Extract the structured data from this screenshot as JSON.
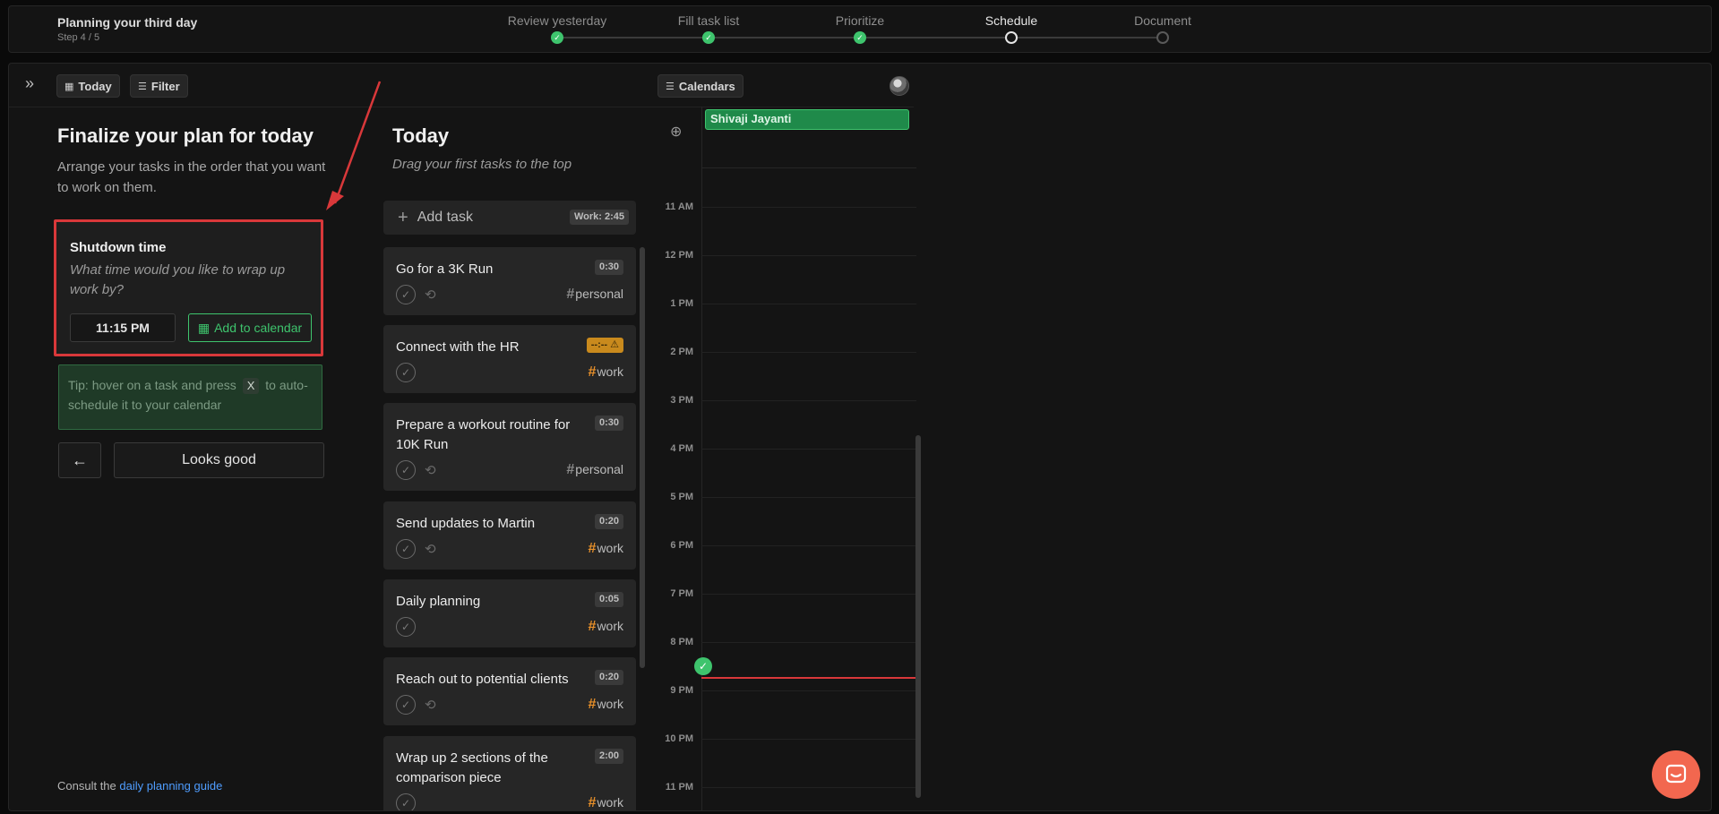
{
  "topbar": {
    "title": "Planning your third day",
    "step_text": "Step 4 / 5",
    "steps": [
      {
        "label": "Review yesterday",
        "state": "done"
      },
      {
        "label": "Fill task list",
        "state": "done"
      },
      {
        "label": "Prioritize",
        "state": "done"
      },
      {
        "label": "Schedule",
        "state": "current"
      },
      {
        "label": "Document",
        "state": "todo"
      }
    ]
  },
  "toolbar": {
    "today_label": "Today",
    "filter_label": "Filter",
    "calendars_label": "Calendars"
  },
  "left": {
    "heading": "Finalize your plan for today",
    "description": "Arrange your tasks in the order that you want to work on them.",
    "shutdown": {
      "title": "Shutdown time",
      "question": "What time would you like to wrap up work by?",
      "time_value": "11:15 PM",
      "add_calendar_label": "Add to calendar"
    },
    "tip": {
      "before": "Tip: hover on a task and press",
      "key": "X",
      "after": "to auto-schedule it to your calendar"
    },
    "back_label": "←",
    "looks_good_label": "Looks good",
    "guide_prefix": "Consult the",
    "guide_link": "daily planning guide"
  },
  "tasks": {
    "heading": "Today",
    "hint": "Drag your first tasks to the top",
    "add_task_label": "Add task",
    "work_total": "Work: 2:45",
    "items": [
      {
        "title": "Go for a 3K Run",
        "duration": "0:30",
        "tag": "personal",
        "recurring": true,
        "warn": false
      },
      {
        "title": "Connect with the HR",
        "duration": "--:-- ⚠",
        "tag": "work",
        "recurring": false,
        "warn": true
      },
      {
        "title": "Prepare a workout routine for 10K Run",
        "duration": "0:30",
        "tag": "personal",
        "recurring": true,
        "warn": false
      },
      {
        "title": "Send updates to Martin",
        "duration": "0:20",
        "tag": "work",
        "recurring": true,
        "warn": false
      },
      {
        "title": "Daily planning",
        "duration": "0:05",
        "tag": "work",
        "recurring": false,
        "warn": false
      },
      {
        "title": "Reach out to potential clients",
        "duration": "0:20",
        "tag": "work",
        "recurring": true,
        "warn": false
      },
      {
        "title": "Wrap up 2 sections of the comparison piece",
        "duration": "2:00",
        "tag": "work",
        "recurring": false,
        "warn": false
      }
    ]
  },
  "calendar": {
    "allday_event": "Shivaji Jayanti",
    "hours": [
      "11 AM",
      "12 PM",
      "1 PM",
      "2 PM",
      "3 PM",
      "4 PM",
      "5 PM",
      "6 PM",
      "7 PM",
      "8 PM",
      "9 PM",
      "10 PM",
      "11 PM"
    ]
  },
  "colors": {
    "accent_green": "#3ec46d",
    "highlight_red": "#d9383a",
    "tag_work": "#e8902a",
    "chat": "#f2674f"
  }
}
